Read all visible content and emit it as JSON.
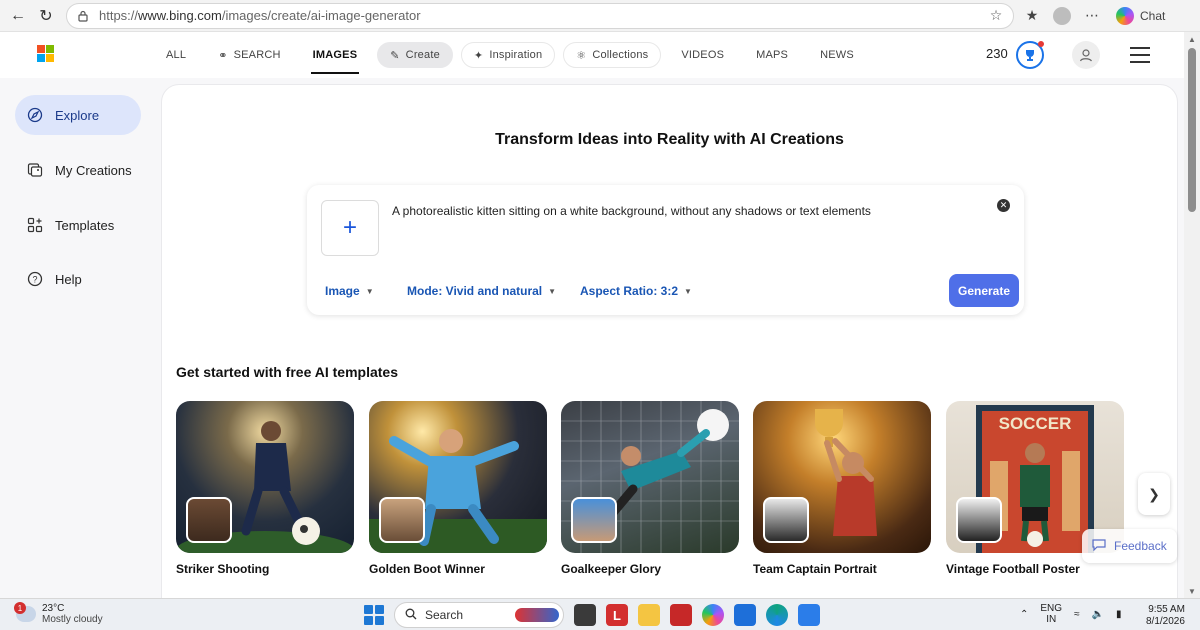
{
  "browser": {
    "url_scheme": "https://",
    "url_host": "www.bing.com",
    "url_path": "/images/create/ai-image-generator",
    "chat_label": "Chat"
  },
  "header": {
    "tabs": [
      {
        "label": "ALL"
      },
      {
        "label": "SEARCH"
      },
      {
        "label": "IMAGES"
      },
      {
        "label": "Create"
      },
      {
        "label": "Inspiration"
      },
      {
        "label": "Collections"
      },
      {
        "label": "VIDEOS"
      },
      {
        "label": "MAPS"
      },
      {
        "label": "NEWS"
      }
    ],
    "rewards_points": "230"
  },
  "sidebar": {
    "items": [
      {
        "label": "Explore",
        "icon": "compass-icon"
      },
      {
        "label": "My Creations",
        "icon": "image-stack-icon"
      },
      {
        "label": "Templates",
        "icon": "grid-plus-icon"
      },
      {
        "label": "Help",
        "icon": "question-icon"
      }
    ]
  },
  "main": {
    "headline": "Transform Ideas into Reality with AI Creations",
    "prompt": "A photorealistic kitten sitting on a white background, without any shadows or text elements",
    "options": {
      "type": "Image",
      "mode": "Mode: Vivid and natural",
      "aspect": "Aspect Ratio: 3:2"
    },
    "generate_label": "Generate",
    "templates_title": "Get started with free AI templates",
    "templates": [
      {
        "label": "Striker Shooting"
      },
      {
        "label": "Golden Boot Winner"
      },
      {
        "label": "Goalkeeper Glory"
      },
      {
        "label": "Team Captain Portrait"
      },
      {
        "label": "Vintage Football Poster"
      }
    ],
    "feedback_label": "Feedback"
  },
  "taskbar": {
    "weather_temp": "23°C",
    "weather_desc": "Mostly cloudy",
    "weather_badge": "1",
    "search_placeholder": "Search",
    "lang_top": "ENG",
    "lang_bottom": "IN",
    "time": "9:55 AM",
    "date": "8/1/2026"
  },
  "colors": {
    "accent": "#4f6fe8",
    "sidebar_active": "#dde5fb",
    "link_blue": "#1a56b4"
  }
}
